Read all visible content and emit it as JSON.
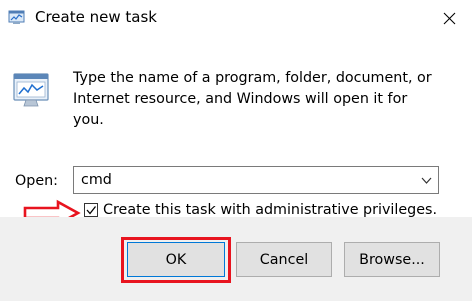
{
  "window": {
    "title": "Create new task",
    "close_icon": "close-icon",
    "app_icon": "task-manager-icon"
  },
  "content": {
    "icon": "run-program-icon",
    "description": "Type the name of a program, folder, document, or Internet resource, and Windows will open it for you.",
    "open_label": "Open:",
    "open_value": "cmd",
    "admin_checkbox": {
      "label": "Create this task with administrative privileges.",
      "checked": true
    }
  },
  "buttons": {
    "ok": "OK",
    "cancel": "Cancel",
    "browse": "Browse..."
  },
  "annotations": {
    "arrow_color": "#e8141f",
    "highlight_color": "#e8141f"
  },
  "colors": {
    "footer_bg": "#f0f0f0",
    "focus_border": "#0078d7"
  }
}
